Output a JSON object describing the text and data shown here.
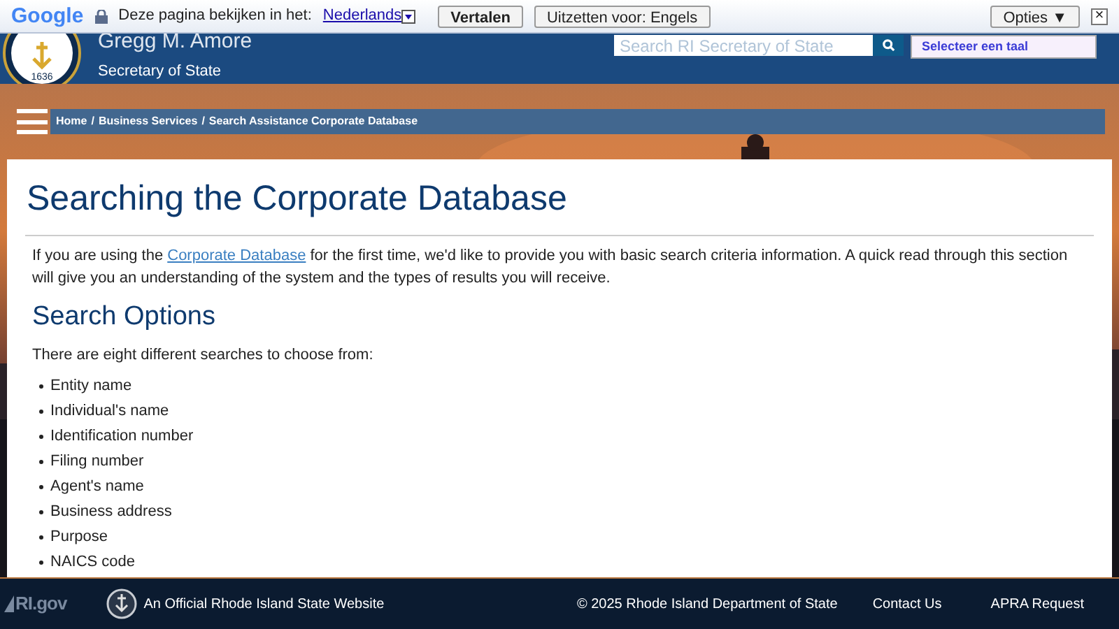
{
  "translate_bar": {
    "brand": "Google",
    "prompt": "Deze pagina bekijken in het:",
    "language": "Nederlands",
    "translate_button": "Vertalen",
    "disable_button": "Uitzetten voor: Engels",
    "options_button": "Opties ▼",
    "close": "×"
  },
  "header": {
    "seal_year": "1636",
    "name": "Gregg M. Amore",
    "title": "Secretary of State",
    "search": {
      "placeholder": "Search RI Secretary of State"
    },
    "language_select": "Selecteer een taal"
  },
  "breadcrumb": [
    {
      "label": "Home"
    },
    {
      "separator": "/",
      "label": "Business Services"
    },
    {
      "separator": "/",
      "label": "Search Assistance Corporate Database"
    }
  ],
  "content": {
    "heading": "Searching the Corporate Database",
    "intro_before": "If you are using the ",
    "intro_link": "Corporate Database",
    "intro_after": " for the first time, we'd like to provide you with basic search criteria information. A quick read through this section will give you an understanding of the system and the types of results you will receive.",
    "subheading": "Search Options",
    "lead": "There are eight different searches to choose from:",
    "options": [
      "Entity name",
      "Individual's name",
      "Identification number",
      "Filing number",
      "Agent's name",
      "Business address",
      "Purpose",
      "NAICS code"
    ]
  },
  "footer": {
    "logo": "RI.gov",
    "official": "An Official Rhode Island State Website",
    "copyright": "© 2025 Rhode Island Department of State",
    "links": [
      "Contact Us",
      "APRA Request"
    ]
  }
}
